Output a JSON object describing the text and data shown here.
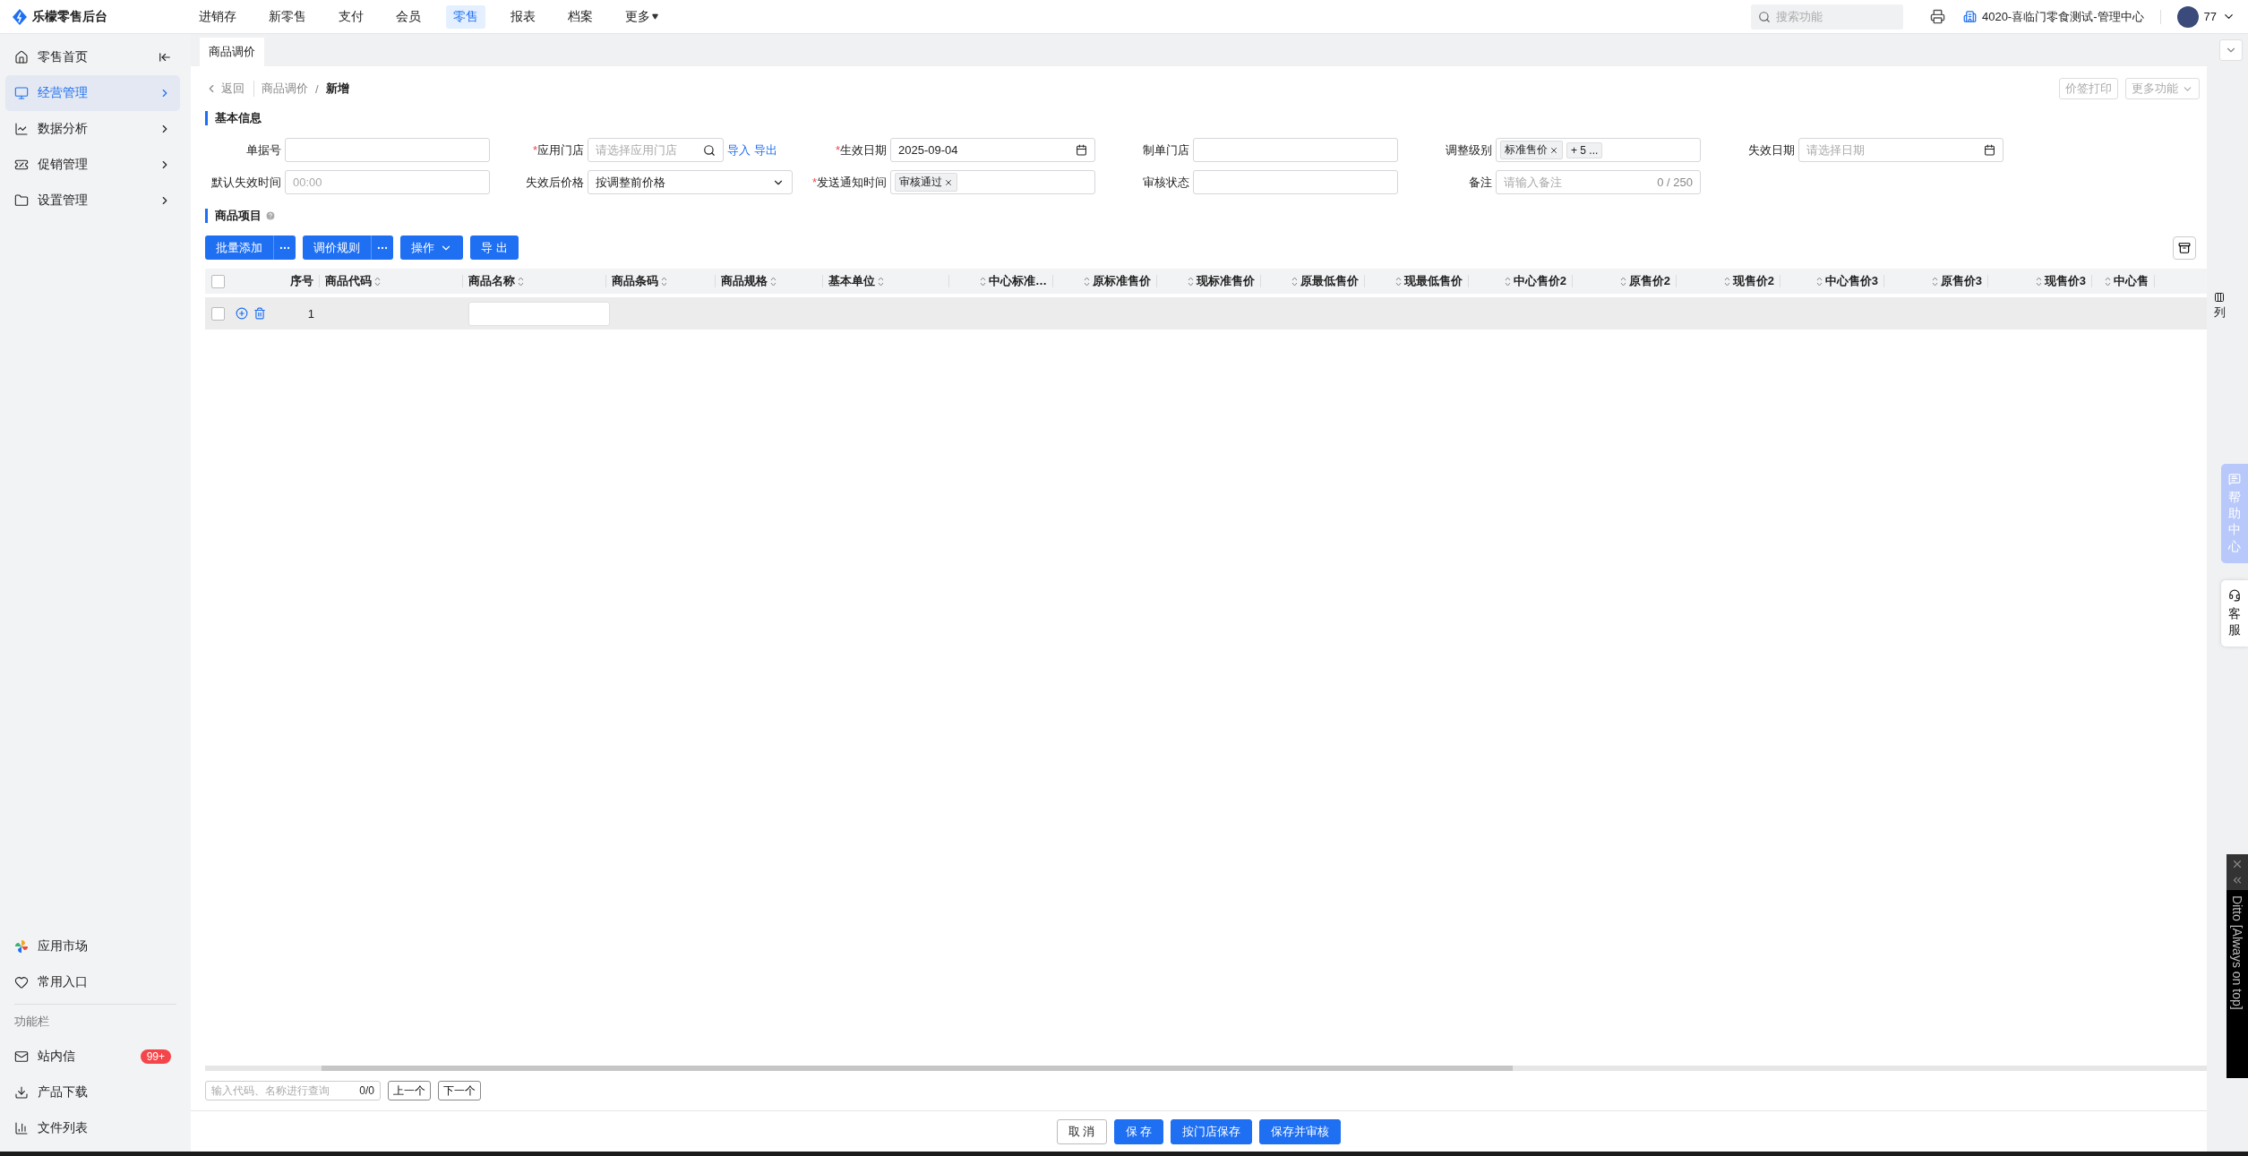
{
  "topbar": {
    "brand": "乐檬零售后台",
    "nav": [
      {
        "label": "进销存",
        "selected": false
      },
      {
        "label": "新零售",
        "selected": false
      },
      {
        "label": "支付",
        "selected": false
      },
      {
        "label": "会员",
        "selected": false
      },
      {
        "label": "零售",
        "selected": true
      },
      {
        "label": "报表",
        "selected": false
      },
      {
        "label": "档案",
        "selected": false
      },
      {
        "label": "更多",
        "selected": false,
        "dropdown": true
      }
    ],
    "search": {
      "placeholder": "搜索功能"
    },
    "store": "4020-喜临门零食测试-管理中心",
    "user": "77"
  },
  "sidebar": {
    "items": [
      {
        "label": "零售首页",
        "selected": false
      },
      {
        "label": "经营管理",
        "selected": true
      },
      {
        "label": "数据分析",
        "selected": false
      },
      {
        "label": "促销管理",
        "selected": false
      },
      {
        "label": "设置管理",
        "selected": false
      }
    ],
    "bottom_items": [
      {
        "label": "应用市场"
      },
      {
        "label": "常用入口"
      }
    ],
    "section_label": "功能栏",
    "tools": [
      {
        "label": "站内信",
        "badge": "99+"
      },
      {
        "label": "产品下载"
      },
      {
        "label": "文件列表"
      }
    ]
  },
  "tabs": [
    {
      "label": "商品调价",
      "selected": true
    }
  ],
  "breadcrumb": {
    "back": "返回",
    "path": [
      "商品调价"
    ],
    "separator": "/",
    "current": "新增"
  },
  "header_buttons": [
    {
      "label": "价签打印",
      "disabled": true,
      "dropdown": false
    },
    {
      "label": "更多功能",
      "disabled": true,
      "dropdown": true
    }
  ],
  "basic_info": {
    "title": "基本信息",
    "required_mark": "*",
    "fields": [
      {
        "label": "单据号",
        "required": false,
        "kind": "text"
      },
      {
        "label": "应用门店",
        "required": true,
        "kind": "search",
        "placeholder": "请选择应用门店",
        "links": [
          "导入",
          "导出"
        ]
      },
      {
        "label": "生效日期",
        "required": true,
        "kind": "date",
        "value": "2025-09-04"
      },
      {
        "label": "制单门店",
        "required": false,
        "kind": "text"
      },
      {
        "label": "调整级别",
        "required": false,
        "kind": "tags",
        "tags": [
          {
            "label": "标准售价",
            "closable": true
          },
          {
            "label": "+ 5 ...",
            "closable": false
          }
        ]
      },
      {
        "label": "失效日期",
        "required": false,
        "kind": "date",
        "placeholder": "请选择日期"
      },
      {
        "label": "默认失效时间",
        "required": false,
        "kind": "text",
        "placeholder": "00:00"
      },
      {
        "label": "失效后价格",
        "required": false,
        "kind": "select",
        "value": "按调整前价格"
      },
      {
        "label": "发送通知时间",
        "required": true,
        "kind": "tags",
        "tags": [
          {
            "label": "审核通过",
            "closable": true
          }
        ]
      },
      {
        "label": "审核状态",
        "required": false,
        "kind": "text"
      },
      {
        "label": "备注",
        "required": false,
        "kind": "counter",
        "placeholder": "请输入备注",
        "counter": "0 / 250"
      }
    ]
  },
  "items": {
    "title": "商品项目",
    "toolbar": [
      {
        "label": "批量添加",
        "kind": "split"
      },
      {
        "label": "调价规则",
        "kind": "split"
      },
      {
        "label": "操作",
        "kind": "dropdown"
      },
      {
        "label": "导 出",
        "kind": "plain"
      }
    ],
    "table": {
      "select_all": {
        "checked": false
      },
      "columns": [
        {
          "label": "序号",
          "sortable": false
        },
        {
          "label": "商品代码",
          "sortable": true
        },
        {
          "label": "商品名称",
          "sortable": true
        },
        {
          "label": "商品条码",
          "sortable": true
        },
        {
          "label": "商品规格",
          "sortable": true
        },
        {
          "label": "基本单位",
          "sortable": true
        },
        {
          "label": "中心标准…",
          "sortable": true
        },
        {
          "label": "原标准售价",
          "sortable": true
        },
        {
          "label": "现标准售价",
          "sortable": true
        },
        {
          "label": "原最低售价",
          "sortable": true
        },
        {
          "label": "现最低售价",
          "sortable": true
        },
        {
          "label": "中心售价2",
          "sortable": true
        },
        {
          "label": "原售价2",
          "sortable": true
        },
        {
          "label": "现售价2",
          "sortable": true
        },
        {
          "label": "中心售价3",
          "sortable": true
        },
        {
          "label": "原售价3",
          "sortable": true
        },
        {
          "label": "现售价3",
          "sortable": true
        },
        {
          "label": "中心售",
          "sortable": true
        }
      ],
      "column_setting": "列",
      "rows": [
        {
          "checked": false,
          "seq": "1"
        }
      ]
    },
    "finder": {
      "placeholder": "输入代码、名称进行查询",
      "count": "0/0",
      "prev": "上一个",
      "next": "下一个"
    }
  },
  "footer_buttons": [
    {
      "label": "取 消",
      "primary": false
    },
    {
      "label": "保 存",
      "primary": true
    },
    {
      "label": "按门店保存",
      "primary": true
    },
    {
      "label": "保存并审核",
      "primary": true
    }
  ],
  "side_tabs": [
    {
      "label": "帮助中心",
      "kind": "help"
    },
    {
      "label": "客服",
      "kind": "service"
    }
  ],
  "ditto": {
    "title": "Ditto [Always on top]"
  }
}
